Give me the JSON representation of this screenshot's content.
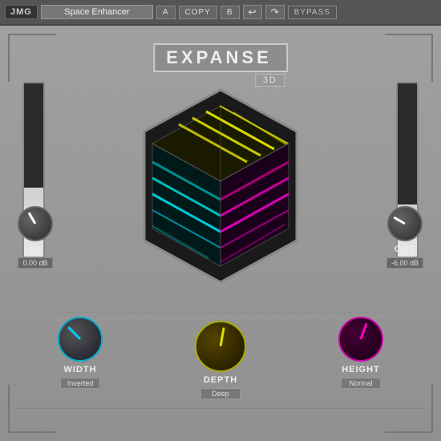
{
  "topbar": {
    "logo": "JMG",
    "preset_name": "Space Enhancer",
    "btn_a": "A",
    "btn_copy": "COPY",
    "btn_b": "B",
    "btn_undo": "↩",
    "btn_redo": "↷",
    "btn_bypass": "BYPASS"
  },
  "title": {
    "main": "EXPANSE",
    "sub": "3D"
  },
  "in_knob": {
    "label": "IN",
    "value": "0.00 dB",
    "rotation": -30
  },
  "out_knob": {
    "label": "OUT",
    "value": "-6.00 dB",
    "rotation": -60
  },
  "width_knob": {
    "label": "WIDTH",
    "mode": "Inverted",
    "rotation": -45
  },
  "depth_knob": {
    "label": "DEPTH",
    "mode": "Deep",
    "rotation": 10
  },
  "height_knob": {
    "label": "HEIGHT",
    "mode": "Normal",
    "rotation": 20
  },
  "vu_left": {
    "fill_pct": 40
  },
  "vu_right": {
    "fill_pct": 30
  }
}
